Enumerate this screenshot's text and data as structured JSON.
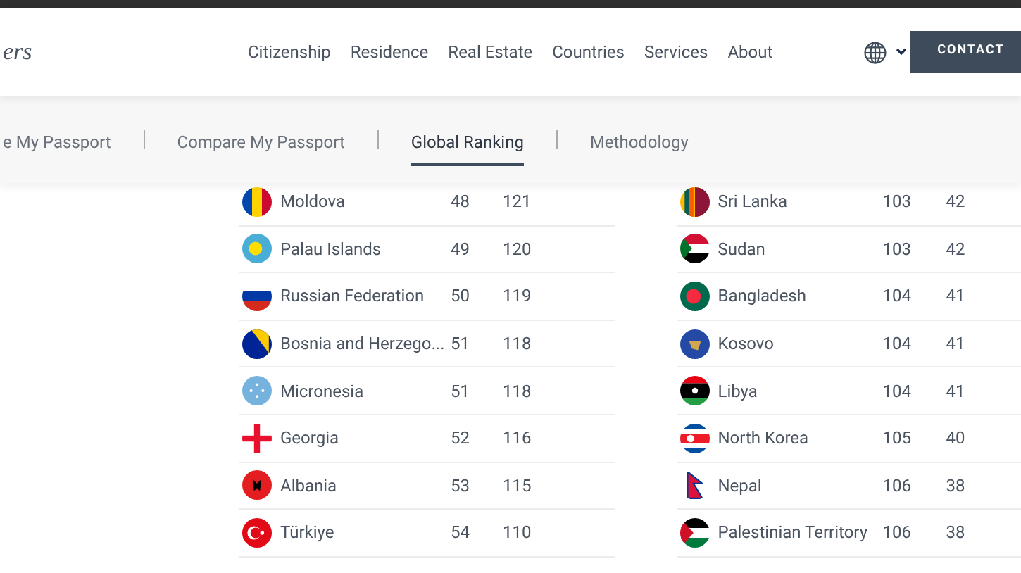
{
  "header": {
    "logo_text": "ers",
    "nav": [
      {
        "label": "Citizenship"
      },
      {
        "label": "Residence"
      },
      {
        "label": "Real Estate"
      },
      {
        "label": "Countries"
      },
      {
        "label": "Services"
      },
      {
        "label": "About"
      }
    ],
    "contact_button": "CONTACT"
  },
  "subnav": [
    {
      "label": "e My Passport",
      "selected": false
    },
    {
      "label": "Compare My Passport",
      "selected": false
    },
    {
      "label": "Global Ranking",
      "selected": true
    },
    {
      "label": "Methodology",
      "selected": false
    }
  ],
  "ranking_columns": [
    {
      "rows": [
        {
          "country": "Moldova",
          "rank": "48",
          "score": "121"
        },
        {
          "country": "Palau Islands",
          "rank": "49",
          "score": "120"
        },
        {
          "country": "Russian Federation",
          "rank": "50",
          "score": "119"
        },
        {
          "country": "Bosnia and Herzego...",
          "rank": "51",
          "score": "118"
        },
        {
          "country": "Micronesia",
          "rank": "51",
          "score": "118"
        },
        {
          "country": "Georgia",
          "rank": "52",
          "score": "116"
        },
        {
          "country": "Albania",
          "rank": "53",
          "score": "115"
        },
        {
          "country": "Türkiye",
          "rank": "54",
          "score": "110"
        }
      ]
    },
    {
      "rows": [
        {
          "country": "Sri Lanka",
          "rank": "103",
          "score": "42"
        },
        {
          "country": "Sudan",
          "rank": "103",
          "score": "42"
        },
        {
          "country": "Bangladesh",
          "rank": "104",
          "score": "41"
        },
        {
          "country": "Kosovo",
          "rank": "104",
          "score": "41"
        },
        {
          "country": "Libya",
          "rank": "104",
          "score": "41"
        },
        {
          "country": "North Korea",
          "rank": "105",
          "score": "40"
        },
        {
          "country": "Nepal",
          "rank": "106",
          "score": "38"
        },
        {
          "country": "Palestinian Territory",
          "rank": "106",
          "score": "38"
        }
      ]
    }
  ]
}
